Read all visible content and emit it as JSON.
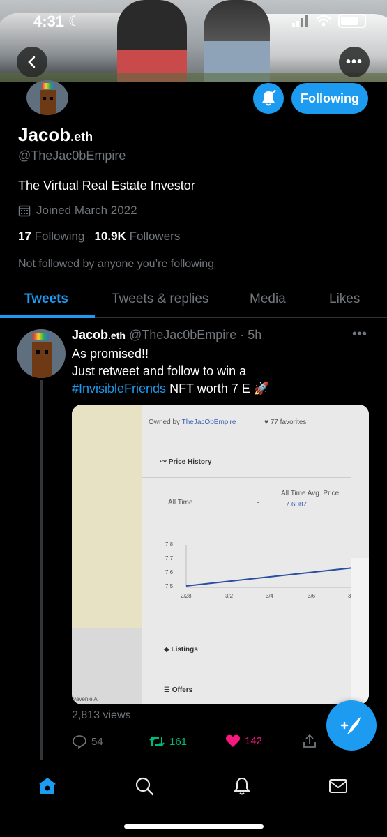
{
  "status": {
    "time": "4:31"
  },
  "profile": {
    "name": "Jacob",
    "name_suffix": ".eth",
    "handle": "@TheJac0bEmpire",
    "bio": "The Virtual Real Estate Investor",
    "joined": "Joined March 2022",
    "following_count": "17",
    "following_label": "Following",
    "followers_count": "10.9K",
    "followers_label": "Followers",
    "not_followed": "Not followed by anyone you’re following",
    "follow_button": "Following"
  },
  "tabs": [
    {
      "label": "Tweets",
      "active": true
    },
    {
      "label": "Tweets & replies",
      "active": false
    },
    {
      "label": "Media",
      "active": false
    },
    {
      "label": "Likes",
      "active": false
    }
  ],
  "tweet": {
    "author": "Jacob",
    "author_suffix": ".eth",
    "handle": "@TheJac0bEmpire",
    "time": "· 5h",
    "line1": "As promised!!",
    "line2": "Just retweet and follow to win a",
    "hashtag": "#InvisibleFriends",
    "line3_rest": " NFT worth 7 E 🚀",
    "views": "2,813 views",
    "replies": "54",
    "retweets": "161",
    "likes": "142",
    "media": {
      "owned_by": "Owned by",
      "owner": "TheJacObEmpire",
      "favorites": "77 favorites",
      "price_history": "Price History",
      "period": "All Time",
      "avg_label": "All Time Avg. Price",
      "avg_value": "Ξ7.6087",
      "yticks": [
        "7.8",
        "7.7",
        "7.6",
        "7.5"
      ],
      "xticks": [
        "2/28",
        "3/2",
        "3/4",
        "3/6",
        "3"
      ],
      "listings": "Listings",
      "offers": "Offers",
      "corner": "yavenie A"
    }
  },
  "colors": {
    "accent": "#1d9bf0",
    "retweet": "#00ba7c",
    "like": "#f91880",
    "muted": "#71767b"
  }
}
